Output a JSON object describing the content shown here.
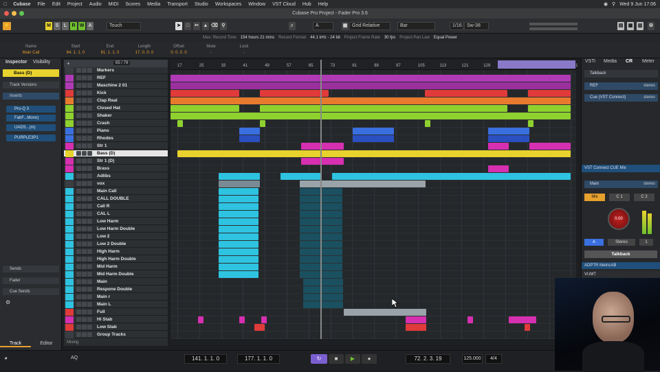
{
  "menubar": {
    "apple": "",
    "app": "Cubase",
    "items": [
      "File",
      "Edit",
      "Project",
      "Audio",
      "MIDI",
      "Scores",
      "Media",
      "Transport",
      "Studio",
      "Workspaces",
      "Window",
      "VST Cloud",
      "Hub",
      "Help"
    ],
    "clock": "Wed 9 Jun  17:06"
  },
  "window": {
    "title": "Cubase Pro Project - Fader Pro 3.6"
  },
  "toolbar": {
    "m": "M",
    "s": "S",
    "l": "L",
    "r": "R",
    "w": "W",
    "a": "A",
    "auto_mode": "Touch",
    "snap_type": "Grid Relative",
    "quantize_type": "Bar",
    "quantize": "1/16",
    "swing": "Sw-38",
    "snap_a": "A"
  },
  "info_line": [
    {
      "label": "Max. Record Time",
      "value": "154 hours 21 mins"
    },
    {
      "label": "Record Format",
      "value": "44.1 kHz - 24 bit"
    },
    {
      "label": "Project Frame Rate",
      "value": "30 fps"
    },
    {
      "label": "Project Pan Law",
      "value": "Equal Power"
    }
  ],
  "info_header": {
    "name_label": "Name",
    "name_value": "Main Call",
    "start_label": "Start",
    "start_value": "64. 1. 1. 0",
    "end_label": "End",
    "end_value": "81. 1. 1. 0",
    "length_label": "Length",
    "length_value": "17. 0. 0. 0",
    "offset_label": "Offset",
    "offset_value": "0. 0. 0. 0",
    "mute_label": "Mute",
    "mute_value": "-",
    "lock_label": "Lock",
    "lock_value": "-"
  },
  "inspector": {
    "tab1": "Inspector",
    "tab2": "Visibility",
    "track_name": "Bass (D)",
    "track_versions": "Track Versions",
    "inserts": "Inserts",
    "slots": [
      "Pro-Q 3",
      "FabF...Mono)",
      "UADS...(m)",
      "PURPLE3P1"
    ],
    "sends": "Sends",
    "fader": "Fader",
    "cue_sends": "Cue Sends"
  },
  "track_header": {
    "counter": "65 / 79"
  },
  "tracks": [
    {
      "name": "Markers",
      "color": "#3a3d41"
    },
    {
      "name": "REF",
      "color": "#b03ab6"
    },
    {
      "name": "Maschine 2 01",
      "color": "#b03ab6"
    },
    {
      "name": "Kick",
      "color": "#e03a3a"
    },
    {
      "name": "Clap Real",
      "color": "#e87a2e"
    },
    {
      "name": "Closed Hat",
      "color": "#8fd12e"
    },
    {
      "name": "Shaker",
      "color": "#8fd12e"
    },
    {
      "name": "Crash",
      "color": "#8fd12e"
    },
    {
      "name": "Piano",
      "color": "#3a6fe0"
    },
    {
      "name": "Rhodes",
      "color": "#3a6fe0"
    },
    {
      "name": "Str 1",
      "color": "#d62fb0"
    },
    {
      "name": "Bass (D)",
      "color": "#e8d22e"
    },
    {
      "name": "Str 1 (D)",
      "color": "#d62fb0"
    },
    {
      "name": "Brass",
      "color": "#d62fb0"
    },
    {
      "name": "Adlibs",
      "color": "#2ec3e0"
    },
    {
      "name": "vox",
      "color": "#3a3d41"
    },
    {
      "name": "Main Call",
      "color": "#2ec3e0"
    },
    {
      "name": "CALL DOUBLE",
      "color": "#2ec3e0"
    },
    {
      "name": "Call R",
      "color": "#2ec3e0"
    },
    {
      "name": "CAL L",
      "color": "#2ec3e0"
    },
    {
      "name": "Low Harm",
      "color": "#2ec3e0"
    },
    {
      "name": "Low Harm Double",
      "color": "#2ec3e0"
    },
    {
      "name": "Low 2",
      "color": "#2ec3e0"
    },
    {
      "name": "Low 2 Double",
      "color": "#2ec3e0"
    },
    {
      "name": "High Harm",
      "color": "#2ec3e0"
    },
    {
      "name": "High Harm Double",
      "color": "#2ec3e0"
    },
    {
      "name": "Mid Harm",
      "color": "#2ec3e0"
    },
    {
      "name": "Mid Harm Double",
      "color": "#2ec3e0"
    },
    {
      "name": "Main",
      "color": "#2ec3e0"
    },
    {
      "name": "Respone Double",
      "color": "#2ec3e0"
    },
    {
      "name": "Main r",
      "color": "#2ec3e0"
    },
    {
      "name": "Main L",
      "color": "#2ec3e0"
    },
    {
      "name": "Full",
      "color": "#e03a3a"
    },
    {
      "name": "Hi Stab",
      "color": "#d62fb0"
    },
    {
      "name": "Low Stab",
      "color": "#e03a3a"
    },
    {
      "name": "Group Tracks",
      "color": "#3a3d41"
    }
  ],
  "ruler": [
    "17",
    "25",
    "33",
    "41",
    "49",
    "57",
    "65",
    "73",
    "81",
    "89",
    "97",
    "105",
    "113",
    "121",
    "129",
    "137",
    "145",
    "153",
    "161"
  ],
  "bottom": {
    "mixing": "Mixing",
    "tab_track": "Track",
    "tab_editor": "Editor"
  },
  "right_zone": {
    "tabs": [
      "VSTi",
      "Media",
      "CR",
      "Meter"
    ],
    "talkback": "Talkback",
    "ref": "REF",
    "ref_fmt": "stereo",
    "cue": "Cue (VST Connect)",
    "cue_fmt": "stereo",
    "vst_connect": "VST Connect CUE Mix",
    "main": "Main",
    "main_fmt": "stereo",
    "mix": "Mix",
    "c1": "C 1",
    "c2": "C 2",
    "knob": "0.00",
    "stereo": "Stereo",
    "one": "1",
    "talkback_btn": "Talkback",
    "adptr": "ADPTR MetricAB",
    "vumt": "VUMT"
  },
  "transport": {
    "left_locator": "141. 1. 1. 0",
    "right_locator": "177. 1. 1. 0",
    "position": "72. 2. 3. 19",
    "tempo": "125.000",
    "signature": "4/4",
    "aq": "AQ",
    "aq2": "AQ"
  }
}
